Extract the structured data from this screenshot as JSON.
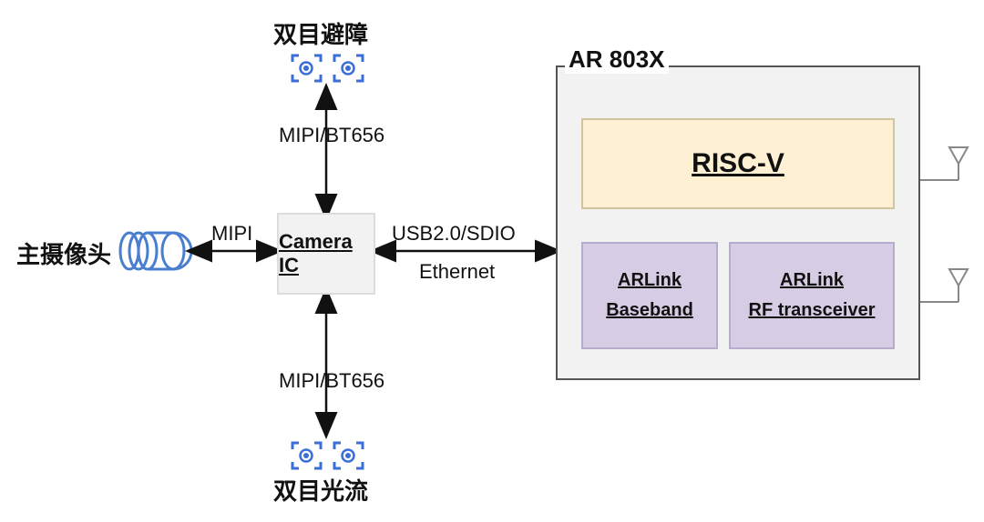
{
  "chart_data": {
    "type": "block-diagram",
    "blocks": [
      {
        "id": "main_camera",
        "label": "主摄像头"
      },
      {
        "id": "stereo_avoid",
        "label": "双目避障"
      },
      {
        "id": "stereo_flow",
        "label": "双目光流"
      },
      {
        "id": "camera_ic",
        "label": "Camera IC"
      },
      {
        "id": "ar803x",
        "label": "AR 803X"
      },
      {
        "id": "riscv",
        "label": "RISC-V",
        "parent": "ar803x"
      },
      {
        "id": "arlink_bb",
        "label": "ARLink Baseband",
        "parent": "ar803x"
      },
      {
        "id": "arlink_rf",
        "label": "ARLink RF transceiver",
        "parent": "ar803x"
      },
      {
        "id": "antenna_top",
        "label": "antenna",
        "parent_port": "ar803x"
      },
      {
        "id": "antenna_bottom",
        "label": "antenna",
        "parent_port": "ar803x"
      }
    ],
    "edges": [
      {
        "from": "main_camera",
        "to": "camera_ic",
        "label": "MIPI",
        "bidirectional": true
      },
      {
        "from": "stereo_avoid",
        "to": "camera_ic",
        "label": "MIPI/BT656",
        "bidirectional": true
      },
      {
        "from": "stereo_flow",
        "to": "camera_ic",
        "label": "MIPI/BT656",
        "bidirectional": true
      },
      {
        "from": "camera_ic",
        "to": "ar803x",
        "label": "USB2.0/SDIO Ethernet",
        "bidirectional": true
      },
      {
        "from": "ar803x",
        "to": "antenna_top",
        "label": "",
        "bidirectional": false
      },
      {
        "from": "ar803x",
        "to": "antenna_bottom",
        "label": "",
        "bidirectional": false
      }
    ]
  },
  "labels": {
    "main_camera": "主摄像头",
    "stereo_avoid": "双目避障",
    "stereo_flow": "双目光流",
    "camera_ic": "Camera IC",
    "ar_box_title": "AR 803X",
    "riscv": "RISC-V",
    "arlink_bb_l1": "ARLink",
    "arlink_bb_l2": "Baseband",
    "arlink_rf_l1": "ARLink",
    "arlink_rf_l2": "RF transceiver",
    "edge_mipi": "MIPI",
    "edge_mipi_bt656_top": "MIPI/BT656",
    "edge_mipi_bt656_bot": "MIPI/BT656",
    "edge_usb_l1": "USB2.0/SDIO",
    "edge_usb_l2": "Ethernet"
  }
}
